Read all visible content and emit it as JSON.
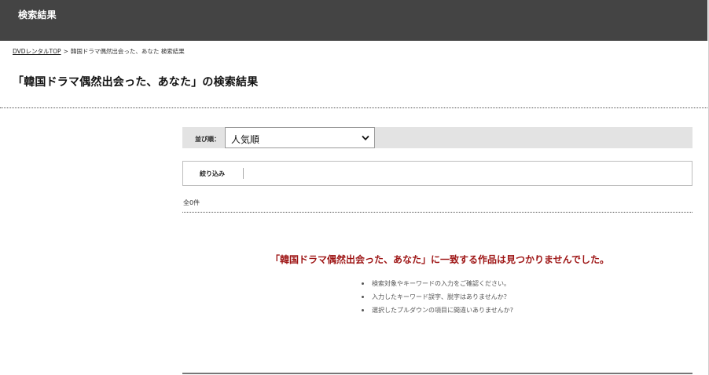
{
  "header": {
    "title": "検索結果",
    "bg_color": "#444444"
  },
  "breadcrumb": {
    "home_label": "DVDレンタルTOP",
    "separator": ">",
    "current": "韓国ドラマ偶然出会った、あなた 検索結果"
  },
  "page_title": "「韓国ドラマ偶然出会った、あなた」の検索結果",
  "sort": {
    "label": "並び順：",
    "selected": "人気順"
  },
  "filter": {
    "label": "絞り込み"
  },
  "result_count": "全0件",
  "no_results": {
    "message": "「韓国ドラマ偶然出会った、あなた」に一致する作品は見つかりませんでした。",
    "color": "#9e1515",
    "hints": [
      "検索対象やキーワードの入力をご確認ください。",
      "入力したキーワード誤字、脱字はありませんか？",
      "選択したプルダウンの項目に間違いありませんか?"
    ]
  }
}
